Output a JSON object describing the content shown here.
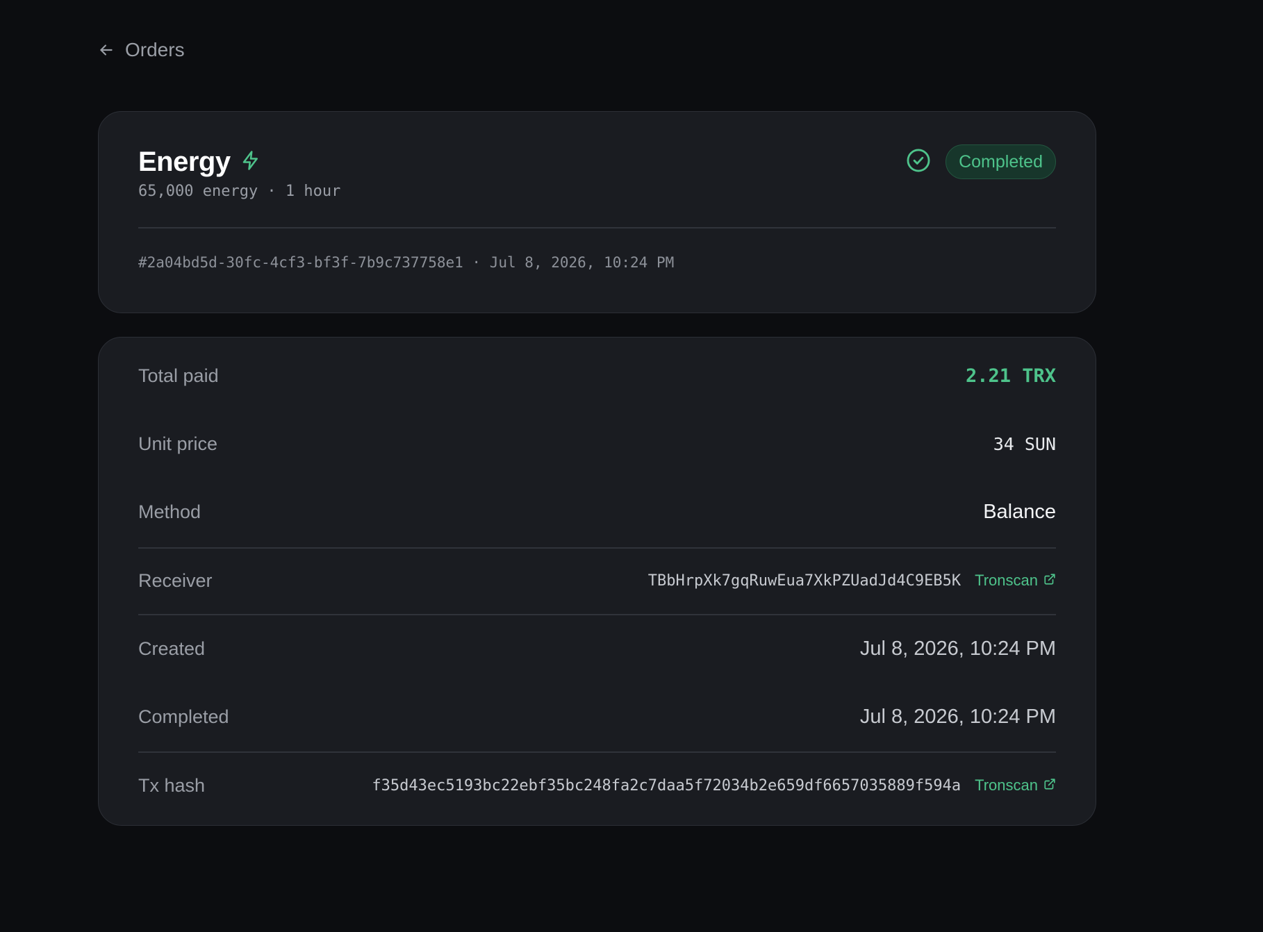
{
  "nav": {
    "back_label": "Orders"
  },
  "order": {
    "product_name": "Energy",
    "product_subtitle": "65,000 energy · 1 hour",
    "status": "Completed",
    "meta": "#2a04bd5d-30fc-4cf3-bf3f-7b9c737758e1 · Jul 8, 2026, 10:24 PM"
  },
  "details": {
    "total_paid": {
      "label": "Total paid",
      "value": "2.21 TRX"
    },
    "unit_price": {
      "label": "Unit price",
      "value": "34 SUN"
    },
    "method": {
      "label": "Method",
      "value": "Balance"
    },
    "receiver": {
      "label": "Receiver",
      "value": "TBbHrpXk7gqRuwEua7XkPZUadJd4C9EB5K",
      "link": "Tronscan"
    },
    "created": {
      "label": "Created",
      "value": "Jul 8, 2026, 10:24 PM"
    },
    "completed": {
      "label": "Completed",
      "value": "Jul 8, 2026, 10:24 PM"
    },
    "tx_hash": {
      "label": "Tx hash",
      "value": "f35d43ec5193bc22ebf35bc248fa2c7daa5f72034b2e659df6657035889f594a",
      "link": "Tronscan"
    }
  },
  "icons": {
    "back": "arrow-left-icon",
    "product": "lightning-bolt-icon",
    "status": "check-circle-icon",
    "external": "external-link-icon"
  },
  "colors": {
    "background": "#0c0d10",
    "card": "#1a1c21",
    "accent": "#4ec38b",
    "badge_bg": "#17362b"
  }
}
